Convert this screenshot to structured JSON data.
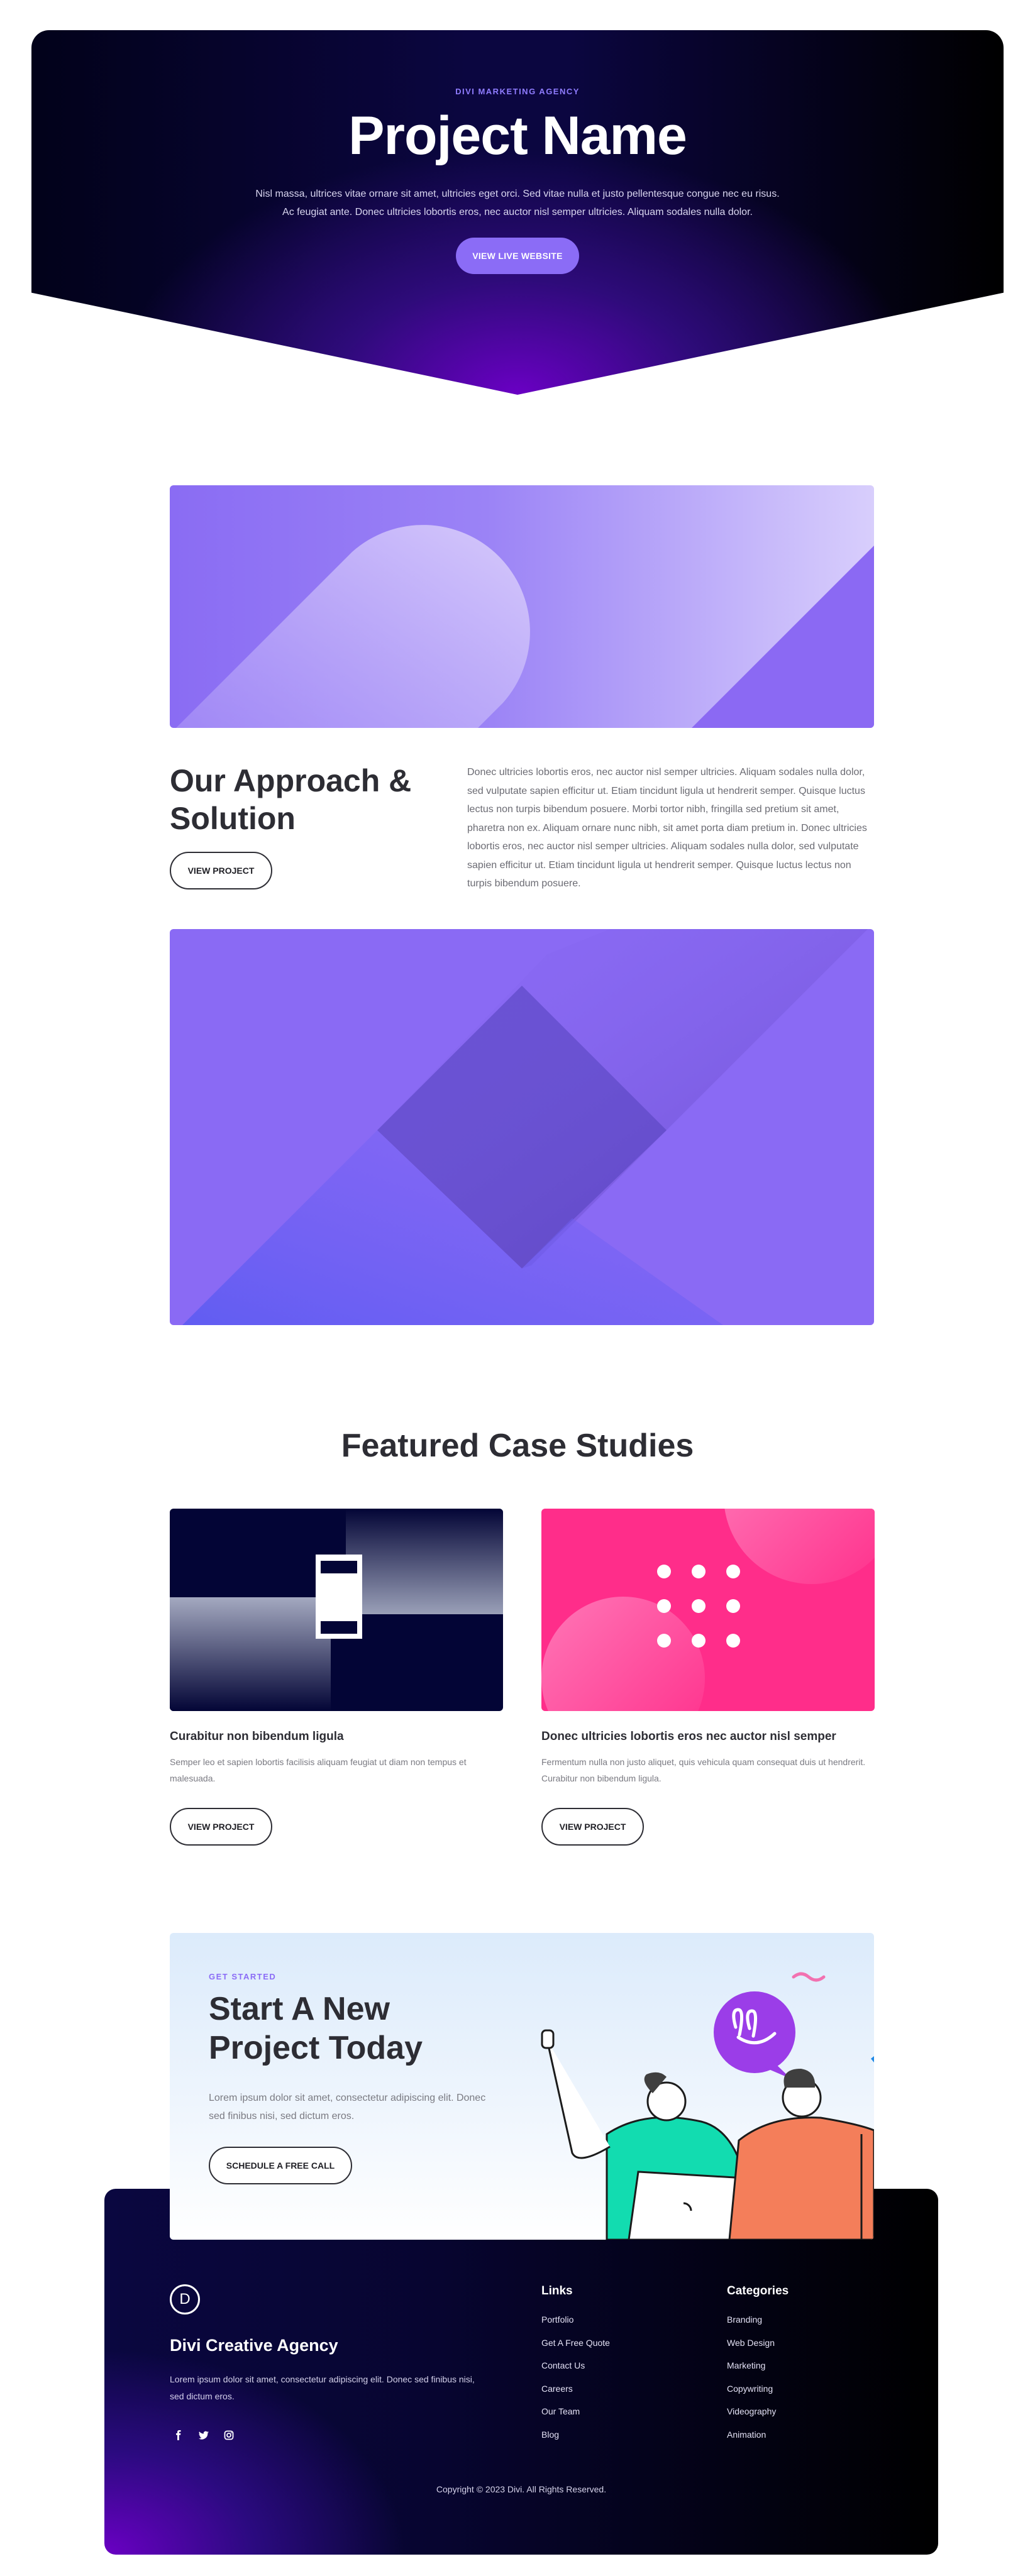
{
  "hero": {
    "eyebrow": "DIVI MARKETING AGENCY",
    "title": "Project Name",
    "description": "Nisl massa, ultrices vitae ornare sit amet, ultricies eget orci. Sed vitae nulla et justo pellentesque congue nec eu risus. Ac feugiat ante. Donec ultricies lobortis eros, nec auctor nisl semper ultricies. Aliquam sodales nulla dolor.",
    "button": "VIEW LIVE WEBSITE"
  },
  "approach": {
    "title": "Our Approach & Solution",
    "button": "VIEW PROJECT",
    "body": "Donec ultricies lobortis eros, nec auctor nisl semper ultricies. Aliquam sodales nulla dolor, sed vulputate sapien efficitur ut. Etiam tincidunt ligula ut hendrerit semper. Quisque luctus lectus non turpis bibendum posuere. Morbi tortor nibh, fringilla sed pretium sit amet, pharetra non ex. Aliquam ornare nunc nibh, sit amet porta diam pretium in. Donec ultricies lobortis eros, nec auctor nisl semper ultricies. Aliquam sodales nulla dolor, sed vulputate sapien efficitur ut. Etiam tincidunt ligula ut hendrerit semper. Quisque luctus lectus non turpis bibendum posuere."
  },
  "featured": {
    "title": "Featured Case Studies",
    "cases": [
      {
        "title": "Curabitur non bibendum ligula",
        "description": "Semper leo et sapien lobortis facilisis aliquam feugiat ut diam non tempus et malesuada.",
        "button": "VIEW PROJECT"
      },
      {
        "title": "Donec ultricies lobortis eros nec auctor nisl semper",
        "description": "Fermentum nulla non justo aliquet, quis vehicula quam consequat duis ut hendrerit. Curabitur non bibendum ligula.",
        "button": "VIEW PROJECT"
      }
    ]
  },
  "cta": {
    "eyebrow": "GET STARTED",
    "title": "Start A New Project Today",
    "description": "Lorem ipsum dolor sit amet, consectetur adipiscing elit. Donec sed finibus nisi, sed dictum eros.",
    "button": "SCHEDULE A FREE CALL"
  },
  "footer": {
    "logo_letter": "D",
    "brand": "Divi Creative Agency",
    "description": "Lorem ipsum dolor sit amet, consectetur adipiscing elit. Donec sed finibus nisi, sed dictum eros.",
    "social": [
      "facebook-icon",
      "twitter-icon",
      "instagram-icon"
    ],
    "links_title": "Links",
    "links": [
      "Portfolio",
      "Get A Free Quote",
      "Contact Us",
      "Careers",
      "Our Team",
      "Blog"
    ],
    "categories_title": "Categories",
    "categories": [
      "Branding",
      "Web Design",
      "Marketing",
      "Copywriting",
      "Videography",
      "Animation"
    ],
    "copyright": "Copyright © 2023 Divi. All Rights Reserved."
  },
  "colors": {
    "accent": "#8b6cf6",
    "dark": "#2d2d34",
    "pink": "#ff2d8a",
    "navy": "#030536"
  }
}
